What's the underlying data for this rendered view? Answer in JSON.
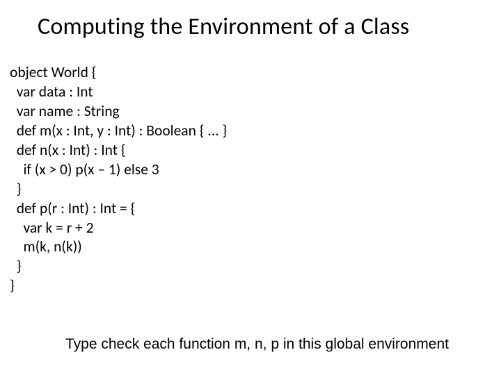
{
  "title": "Computing the Environment of a Class",
  "code": {
    "l01": "object World {",
    "l02": "  var data : Int",
    "l03": "  var name : String",
    "l04": "  def m(x : Int, y : Int) : Boolean { ... }",
    "l05": "  def n(x : Int) : Int {",
    "l06": "    if (x > 0) p(x – 1) else 3",
    "l07": "  }",
    "l08": "  def p(r : Int) : Int = {",
    "l09": "    var k = r + 2",
    "l10": "    m(k, n(k))",
    "l11": "  }",
    "l12": "}"
  },
  "footer": "Type check each function m, n, p in this global environment"
}
